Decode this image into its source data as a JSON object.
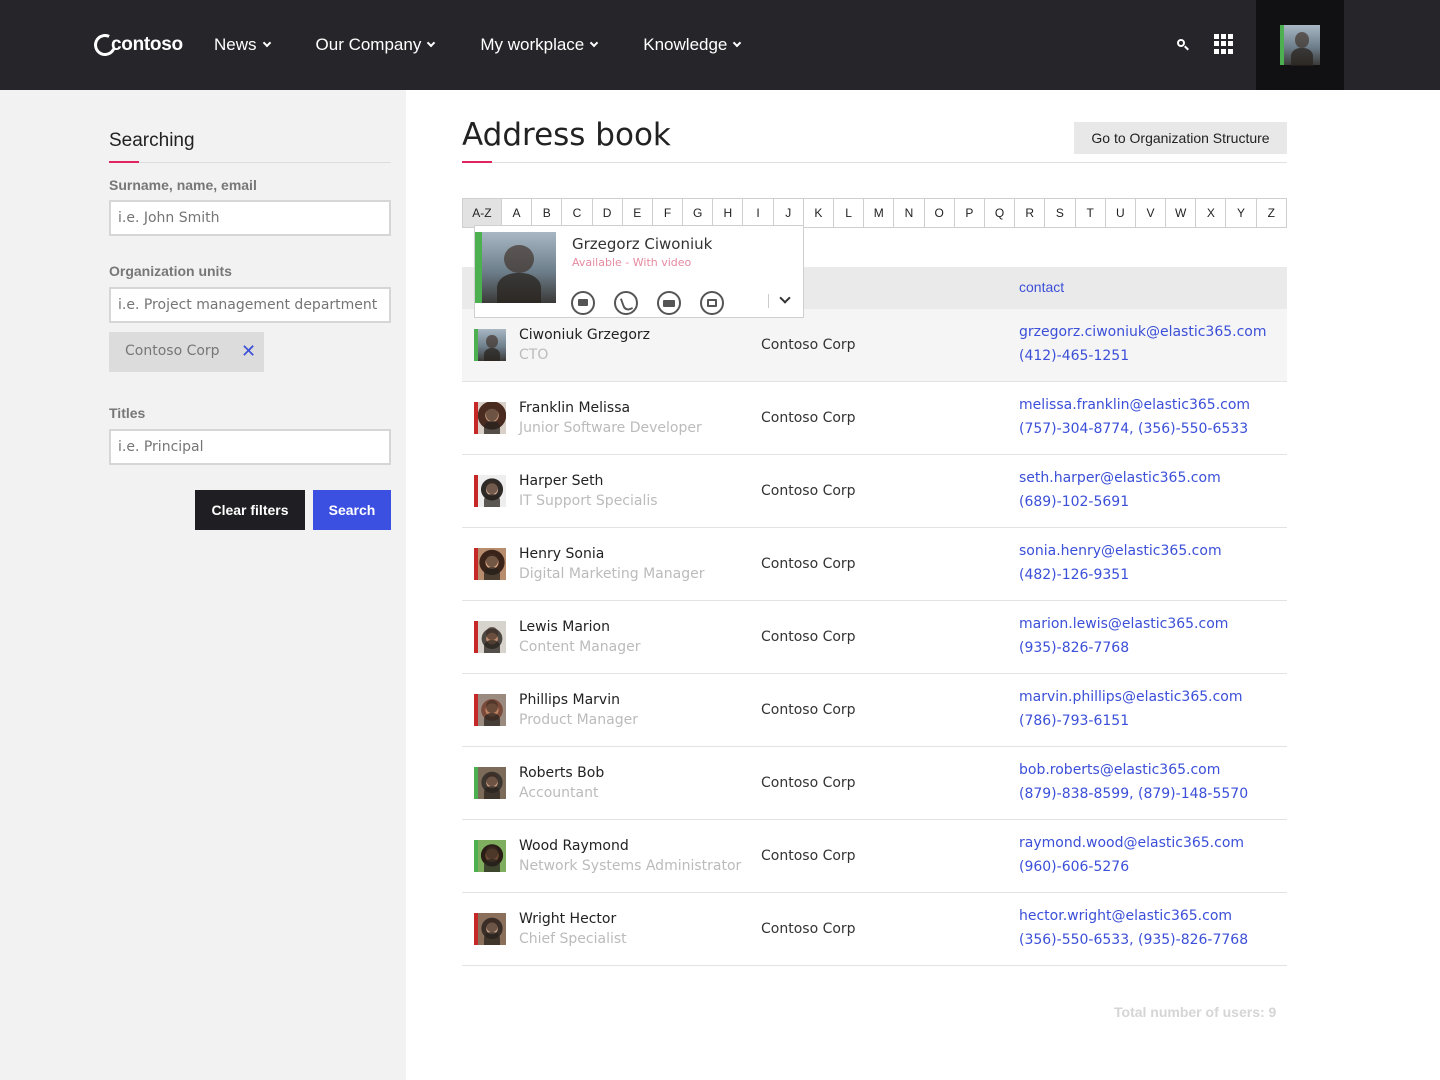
{
  "brand": {
    "logo_text": "contoso"
  },
  "nav": {
    "items": [
      {
        "label": "News"
      },
      {
        "label": "Our Company"
      },
      {
        "label": "My workplace"
      },
      {
        "label": "Knowledge"
      }
    ]
  },
  "sidebar": {
    "title": "Searching",
    "fields": {
      "name_label": "Surname, name, email",
      "name_placeholder": "i.e. John Smith",
      "org_label": "Organization units",
      "org_placeholder": "i.e. Project management department",
      "org_chip": "Contoso Corp",
      "titles_label": "Titles",
      "titles_placeholder": "i.e. Principal"
    },
    "clear_label": "Clear filters",
    "search_label": "Search"
  },
  "main": {
    "title": "Address book",
    "org_button": "Go to Organization Structure",
    "alphabet": [
      "A-Z",
      "A",
      "B",
      "C",
      "D",
      "E",
      "F",
      "G",
      "H",
      "I",
      "J",
      "K",
      "L",
      "M",
      "N",
      "O",
      "P",
      "Q",
      "R",
      "S",
      "T",
      "U",
      "V",
      "W",
      "X",
      "Y",
      "Z"
    ],
    "table": {
      "contact_header": "contact",
      "rows": [
        {
          "name": "Ciwoniuk Grzegorz",
          "role": "CTO",
          "company": "Contoso Corp",
          "email": "grzegorz.ciwoniuk@elastic365.com",
          "phone": "(412)-465-1251"
        },
        {
          "name": "Franklin Melissa",
          "role": "Junior Software Developer",
          "company": "Contoso Corp",
          "email": "melissa.franklin@elastic365.com",
          "phone": "(757)-304-8774, (356)-550-6533"
        },
        {
          "name": "Harper Seth",
          "role": "IT Support Specialis",
          "company": "Contoso Corp",
          "email": "seth.harper@elastic365.com",
          "phone": "(689)-102-5691"
        },
        {
          "name": "Henry Sonia",
          "role": "Digital Marketing Manager",
          "company": "Contoso Corp",
          "email": "sonia.henry@elastic365.com",
          "phone": "(482)-126-9351"
        },
        {
          "name": "Lewis Marion",
          "role": "Content Manager",
          "company": "Contoso Corp",
          "email": "marion.lewis@elastic365.com",
          "phone": "(935)-826-7768"
        },
        {
          "name": "Phillips Marvin",
          "role": "Product Manager",
          "company": "Contoso Corp",
          "email": "marvin.phillips@elastic365.com",
          "phone": "(786)-793-6151"
        },
        {
          "name": "Roberts Bob",
          "role": "Accountant",
          "company": "Contoso Corp",
          "email": "bob.roberts@elastic365.com",
          "phone": "(879)-838-8599, (879)-148-5570"
        },
        {
          "name": "Wood Raymond",
          "role": "Network Systems Administrator",
          "company": "Contoso Corp",
          "email": "raymond.wood@elastic365.com",
          "phone": "(960)-606-5276"
        },
        {
          "name": "Wright Hector",
          "role": "Chief Specialist",
          "company": "Contoso Corp",
          "email": "hector.wright@elastic365.com",
          "phone": "(356)-550-6533, (935)-826-7768"
        }
      ]
    },
    "total": "Total number of users: 9"
  },
  "popup": {
    "name": "Grzegorz Ciwoniuk",
    "status": "Available - With video",
    "actions": [
      "chat-icon",
      "phone-icon",
      "video-icon",
      "mail-icon"
    ]
  },
  "colors": {
    "accent": "#e0245e",
    "link": "#3b4fd8",
    "presence_available": "#4caf50",
    "presence_busy": "#c62828",
    "topbar": "#25252a"
  }
}
